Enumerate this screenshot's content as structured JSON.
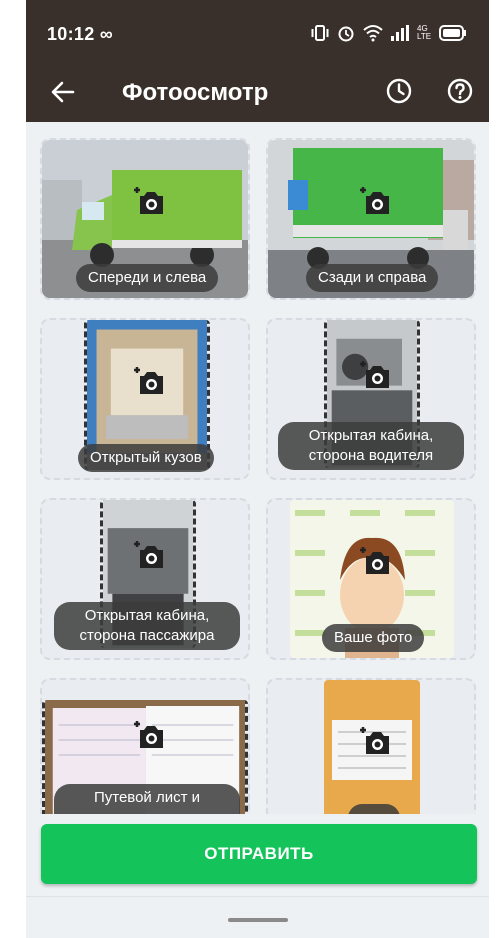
{
  "status_bar": {
    "time": "10:12",
    "infinity_icon": "∞",
    "network_type": "4G LTE",
    "icons": [
      "vibrate-icon",
      "alarm-icon",
      "wifi-icon",
      "signal-icon",
      "battery-icon"
    ]
  },
  "app_bar": {
    "back_icon": "arrow-left-icon",
    "title": "Фотоосмотр",
    "history_icon": "clock-icon",
    "help_icon": "question-icon"
  },
  "photos": [
    {
      "label": "Спереди и слева",
      "image": "van-front-left"
    },
    {
      "label": "Сзади и справа",
      "image": "van-rear-right"
    },
    {
      "label": "Открытый кузов",
      "image": "open-cargo-body"
    },
    {
      "label": "Открытая кабина, сторона водителя",
      "image": "cabin-driver-side"
    },
    {
      "label": "Открытая кабина, сторона пассажира",
      "image": "cabin-passenger-side"
    },
    {
      "label": "Ваше фото",
      "image": "avatar-placeholder"
    },
    {
      "label": "Путевой лист и",
      "image": "waybill-document"
    },
    {
      "label": "",
      "image": "document-sheet"
    }
  ],
  "submit_button": {
    "label": "ОТПРАВИТЬ"
  },
  "colors": {
    "app_bar": "#3a302b",
    "accent_green": "#14c35a",
    "background": "#eef1f4",
    "pill": "#3c3c3c"
  }
}
